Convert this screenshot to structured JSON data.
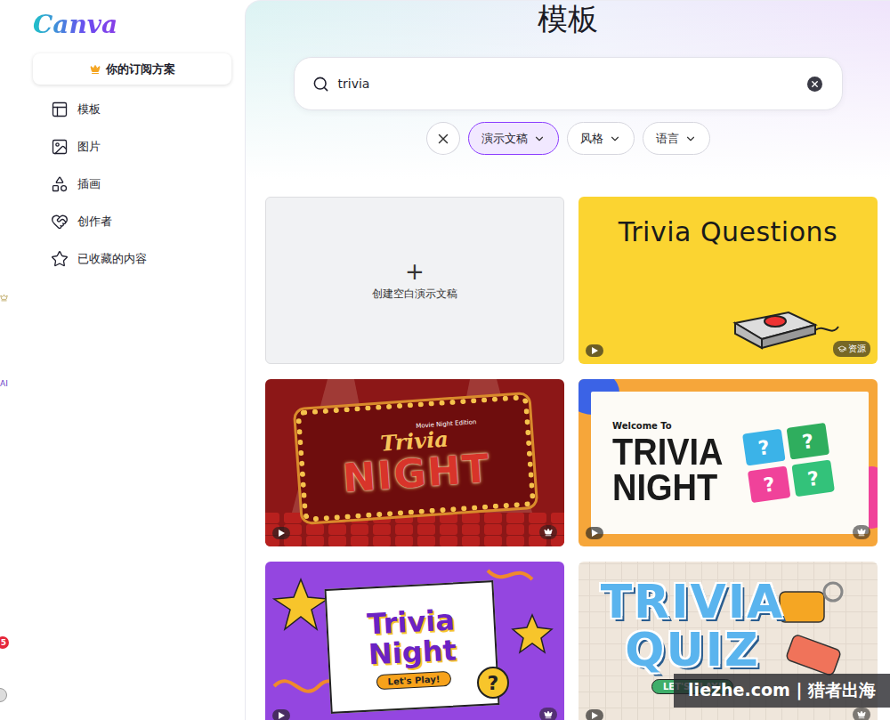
{
  "logo": "Canva",
  "rail": {
    "ai": "AI",
    "badge": "5"
  },
  "sidebar": {
    "subscription": "你的订阅方案",
    "items": [
      {
        "label": "模板",
        "icon": "template"
      },
      {
        "label": "图片",
        "icon": "image"
      },
      {
        "label": "插画",
        "icon": "shapes"
      },
      {
        "label": "创作者",
        "icon": "creator"
      },
      {
        "label": "已收藏的内容",
        "icon": "star"
      }
    ]
  },
  "page_title": "模板",
  "search": {
    "value": "trivia"
  },
  "filters": [
    {
      "label": "演示文稿",
      "selected": true
    },
    {
      "label": "风格",
      "selected": false
    },
    {
      "label": "语言",
      "selected": false
    }
  ],
  "cards": [
    {
      "kind": "blank",
      "icon": "+",
      "label": "创建空白演示文稿"
    },
    {
      "kind": "questions",
      "color": "#fbd431",
      "lines": [
        "Trivia Questions"
      ],
      "badge": "资源",
      "premium": false
    },
    {
      "kind": "marquee",
      "color": "#8c1717",
      "eyebrow": "Movie Night Edition",
      "lines": [
        "Trivia",
        "NIGHT"
      ],
      "premium": true
    },
    {
      "kind": "welcome",
      "color": "#f6a63a",
      "eyebrow": "Welcome To",
      "lines": [
        "TRIVIA",
        "NIGHT"
      ],
      "marks": [
        "?",
        "?",
        "?",
        "?"
      ],
      "premium": true
    },
    {
      "kind": "burst",
      "color": "#9446e0",
      "lines": [
        "Trivia",
        "Night"
      ],
      "footer": "Let's Play!",
      "mark": "?",
      "premium": true
    },
    {
      "kind": "quiz",
      "color": "#efe6db",
      "lines": [
        "TRIVIA",
        "QUIZ"
      ],
      "footer": "LET'S PLAY!",
      "premium": true
    }
  ],
  "watermark": "liezhe.com | 猎者出海"
}
